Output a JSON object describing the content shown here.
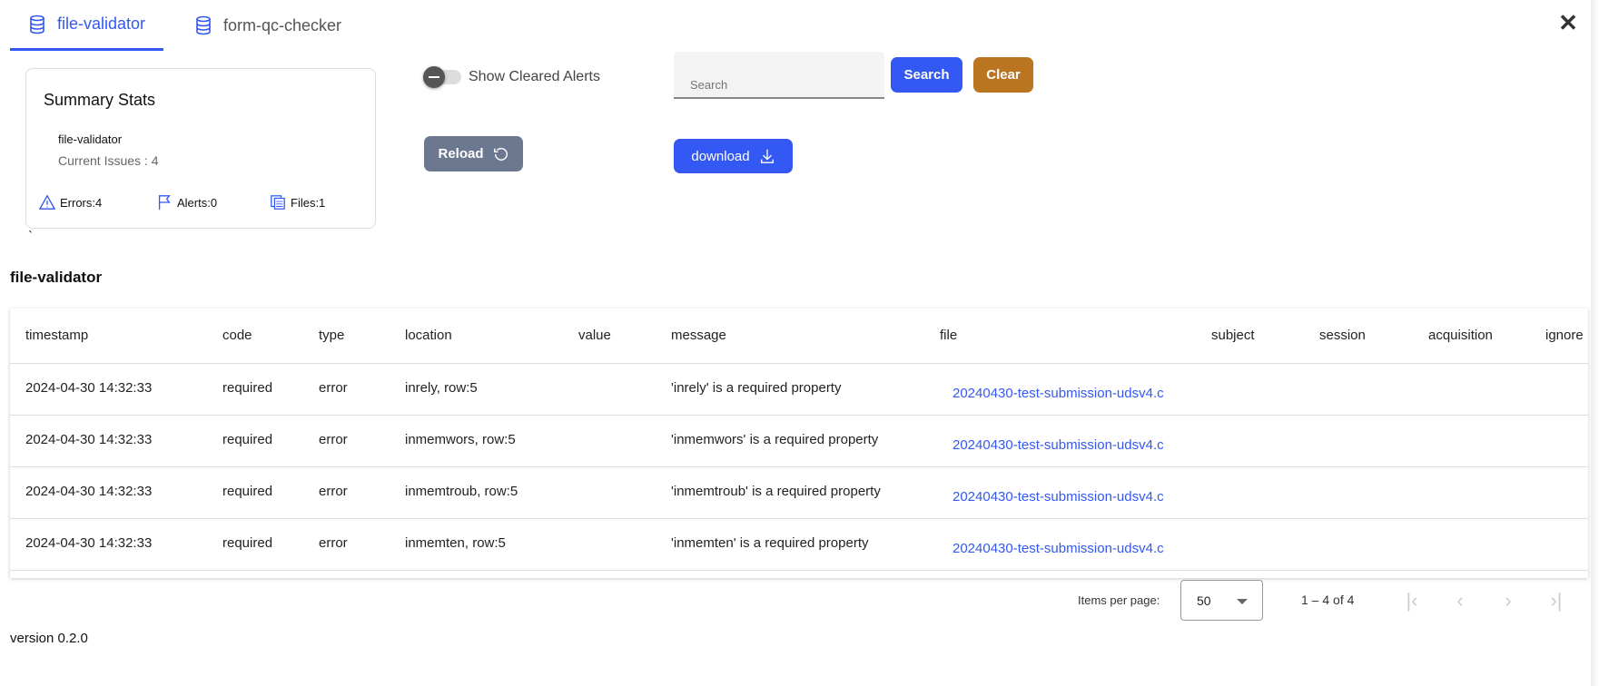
{
  "tabs": [
    {
      "label": "file-validator",
      "icon": "database-icon",
      "active": true
    },
    {
      "label": "form-qc-checker",
      "icon": "database-icon",
      "active": false
    }
  ],
  "close_icon": "✕",
  "summary": {
    "title": "Summary Stats",
    "name": "file-validator",
    "current_issues": "Current Issues : 4",
    "errors": "Errors:4",
    "alerts": "Alerts:0",
    "files": "Files:1"
  },
  "toolbar": {
    "show_cleared_label": "Show Cleared Alerts",
    "search_placeholder": "Search",
    "search_label": "Search",
    "clear_label": "Clear",
    "reload_label": "Reload",
    "download_label": "download"
  },
  "stray_char": "`",
  "section_title": "file-validator",
  "table": {
    "columns": [
      "timestamp",
      "code",
      "type",
      "location",
      "value",
      "message",
      "file",
      "subject",
      "session",
      "acquisition",
      "ignore"
    ],
    "rows": [
      [
        "2024-04-30 14:32:33",
        "required",
        "error",
        "inrely, row:5",
        "",
        "'inrely' is a required property",
        "20240430-test-submission-udsv4.c",
        "",
        "",
        "",
        ""
      ],
      [
        "2024-04-30 14:32:33",
        "required",
        "error",
        "inmemwors, row:5",
        "",
        "'inmemwors' is a required property",
        "20240430-test-submission-udsv4.c",
        "",
        "",
        "",
        ""
      ],
      [
        "2024-04-30 14:32:33",
        "required",
        "error",
        "inmemtroub, row:5",
        "",
        "'inmemtroub' is a required property",
        "20240430-test-submission-udsv4.c",
        "",
        "",
        "",
        ""
      ],
      [
        "2024-04-30 14:32:33",
        "required",
        "error",
        "inmemten, row:5",
        "",
        "'inmemten' is a required property",
        "20240430-test-submission-udsv4.c",
        "",
        "",
        "",
        ""
      ]
    ]
  },
  "pagination": {
    "items_per_page_label": "Items per page:",
    "page_size": "50",
    "range": "1 – 4 of 4"
  },
  "version": "version 0.2.0",
  "colors": {
    "primary": "#3358f4",
    "clear": "#bb7521",
    "reload": "#6b7890"
  }
}
